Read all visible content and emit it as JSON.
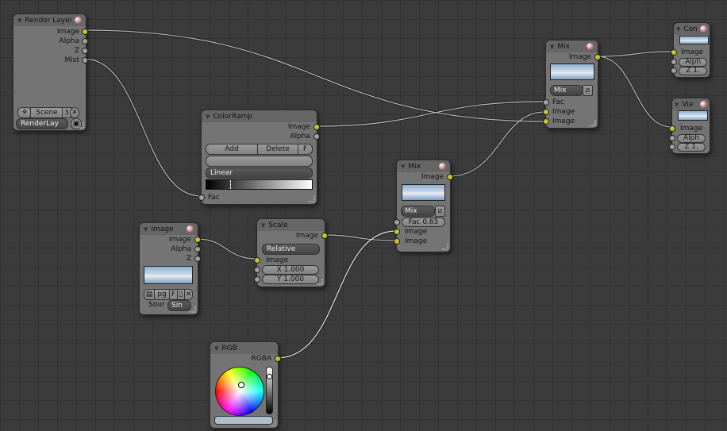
{
  "colors": {
    "socket_color": "#c7c729",
    "socket_value": "#a0a0a0",
    "background": "#3b3b3b",
    "node": "#747474"
  },
  "render_layers": {
    "title": "Render Layers",
    "outputs": [
      "Image",
      "Alpha",
      "Z",
      "Mist"
    ],
    "scene": "Scene",
    "scene_users": "3",
    "layer": "RenderLay"
  },
  "color_ramp": {
    "title": "ColorRamp",
    "outputs": [
      "Image",
      "Alpha"
    ],
    "add": "Add",
    "delete": "Delete",
    "flip": "F",
    "interpolation": "Linear",
    "input": "Fac"
  },
  "mix_top": {
    "title": "Mix",
    "output": "Image",
    "blend": "Mix",
    "inputs": [
      "Fac",
      "Image",
      "Image"
    ]
  },
  "composite": {
    "title": "Com",
    "inputs": [
      "Image",
      "Alph",
      "Z 1."
    ]
  },
  "viewer": {
    "title": "Vie",
    "inputs": [
      "Image",
      "Alph",
      "Z 1."
    ]
  },
  "mix_mid": {
    "title": "Mix",
    "output": "Image",
    "blend": "Mix",
    "fac": "Fac 0.65",
    "inputs": [
      "Image",
      "Image"
    ]
  },
  "image": {
    "title": "Image",
    "outputs": [
      "Image",
      "Alpha",
      "Z"
    ],
    "file": "pg",
    "fake": "F",
    "source_label": "Sour",
    "source": "Sin"
  },
  "scale": {
    "title": "Scale",
    "output": "Image",
    "space": "Relative",
    "input": "Image",
    "x": "X 1.000",
    "y": "Y 1.000"
  },
  "rgb": {
    "title": "RGB",
    "output": "RGBA"
  }
}
